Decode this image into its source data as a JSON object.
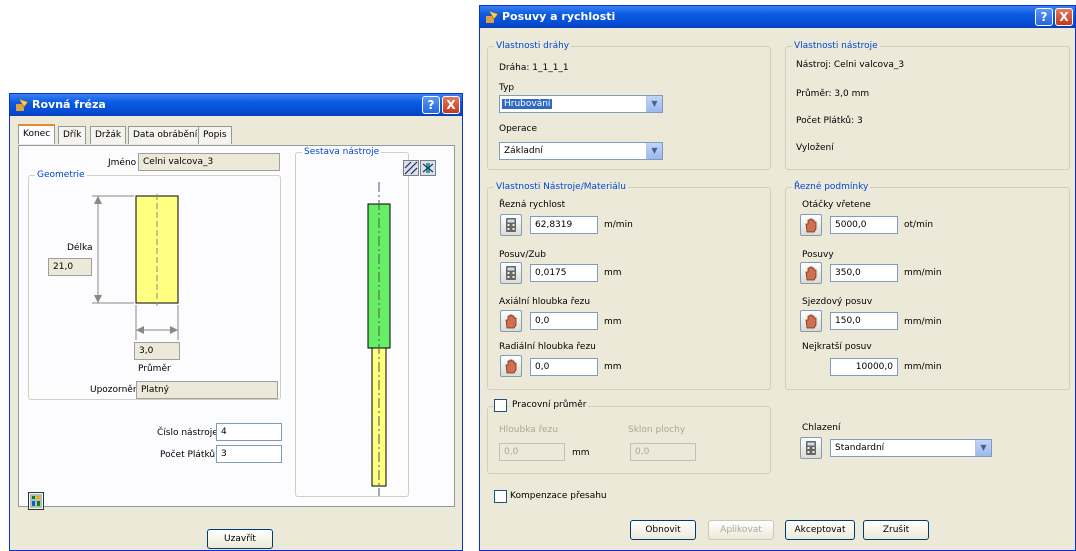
{
  "left": {
    "title": "Rovná fréza",
    "tabs": [
      "Konec",
      "Dřík",
      "Držák",
      "Data obrábění",
      "Popis"
    ],
    "name_label": "Jméno",
    "name_value": "Celni valcova_3",
    "geometry_group": "Geometrie",
    "length_label": "Délka",
    "length_value": "21,0",
    "diameter_value": "3,0",
    "diameter_label": "Průměr",
    "warning_label": "Upozornění",
    "warning_value": "Platný",
    "tool_number_label": "Číslo nástroje",
    "tool_number_value": "4",
    "flutes_label": "Počet Plátků",
    "flutes_value": "3",
    "assembly_group": "Sestava nástroje",
    "close_button": "Uzavřít",
    "help_button": "?",
    "close_x": "X"
  },
  "right": {
    "title": "Posuvy a rychlosti",
    "help_button": "?",
    "close_x": "X",
    "path_props": {
      "group": "Vlastnosti dráhy",
      "path_text": "Dráha: 1_1_1_1",
      "type_label": "Typ",
      "type_value": "Hrubování",
      "operation_label": "Operace",
      "operation_value": "Základní"
    },
    "tool_props": {
      "group": "Vlastnosti nástroje",
      "tool_text": "Nástroj: Celni valcova_3",
      "diameter_text": "Průměr: 3,0 mm",
      "flutes_text": "Počet Plátků: 3",
      "overhang_text": "Vyložení"
    },
    "material": {
      "group": "Vlastnosti Nástroje/Materiálu",
      "cutting_speed_label": "Řezná rychlost",
      "cutting_speed_value": "62,8319",
      "cutting_speed_unit": "m/min",
      "feed_tooth_label": "Posuv/Zub",
      "feed_tooth_value": "0,0175",
      "feed_tooth_unit": "mm",
      "axial_label": "Axiální hloubka řezu",
      "axial_value": "0,0",
      "axial_unit": "mm",
      "radial_label": "Radiální hloubka řezu",
      "radial_value": "0,0",
      "radial_unit": "mm"
    },
    "conditions": {
      "group": "Řezné podmínky",
      "spindle_label": "Otáčky vřetene",
      "spindle_value": "5000,0",
      "spindle_unit": "ot/min",
      "feed_label": "Posuvy",
      "feed_value": "350,0",
      "feed_unit": "mm/min",
      "plunge_label": "Sjezdový posuv",
      "plunge_value": "150,0",
      "plunge_unit": "mm/min",
      "rapid_label": "Nejkratší posuv",
      "rapid_value": "10000,0",
      "rapid_unit": "mm/min"
    },
    "working_diameter": {
      "checkbox_label": "Pracovní průměr",
      "depth_label": "Hloubka řezu",
      "depth_value": "0,0",
      "depth_unit": "mm",
      "slope_label": "Sklon plochy",
      "slope_value": "0,0"
    },
    "coolant": {
      "label": "Chlazení",
      "value": "Standardní"
    },
    "compensation_label": "Kompenzace přesahu",
    "buttons": {
      "reset": "Obnovit",
      "apply": "Aplikovat",
      "accept": "Akceptovat",
      "cancel": "Zrušit"
    }
  },
  "colors": {
    "title_blue": "#0a5ae0",
    "window_bg": "#ece9d8",
    "tool_tip": "#ffff80",
    "tool_shank": "#66ee66",
    "group_title": "#0046d5"
  }
}
